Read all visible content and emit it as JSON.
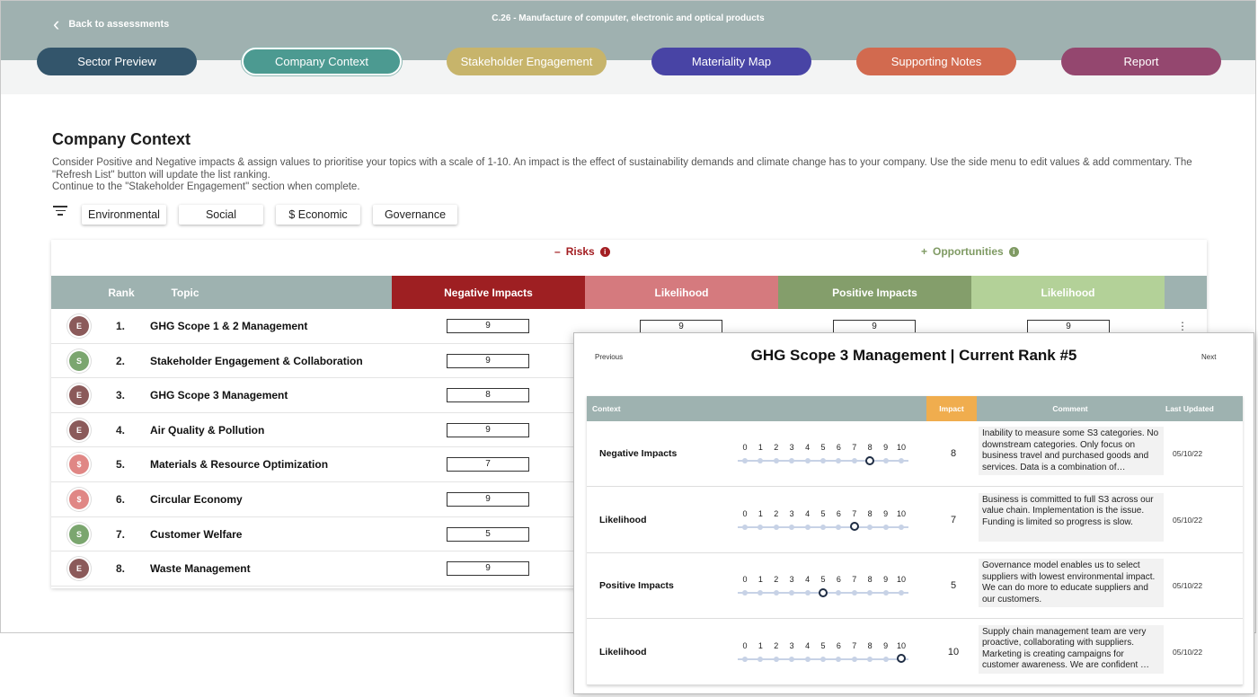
{
  "header": {
    "back_label": "Back to assessments",
    "sector_title": "C.26 - Manufacture of computer, electronic and optical products"
  },
  "nav": [
    {
      "label": "Sector Preview",
      "color": "#33556b"
    },
    {
      "label": "Company Context",
      "color": "#4c9a91",
      "active": true
    },
    {
      "label": "Stakeholder Engagement",
      "color": "#c7b46b"
    },
    {
      "label": "Materiality Map",
      "color": "#4844a5"
    },
    {
      "label": "Supporting Notes",
      "color": "#d26a4f"
    },
    {
      "label": "Report",
      "color": "#94476f"
    }
  ],
  "page": {
    "title": "Company Context",
    "desc_line1": "Consider Positive and Negative impacts & assign values to prioritise your topics with a scale of 1-10. An impact is the effect of sustainability demands and climate change has to your company. Use the side menu to edit values & add commentary. The \"Refresh List\" button will update the list ranking.",
    "desc_line2": "Continue to the \"Stakeholder Engagement\" section when complete."
  },
  "filters": [
    "Environmental",
    "Social",
    "$ Economic",
    "Governance"
  ],
  "sections": {
    "risks": {
      "prefix": "–",
      "label": "Risks",
      "color": "#a31e22"
    },
    "opportunities": {
      "prefix": "+",
      "label": "Opportunities",
      "color": "#7f9a63"
    }
  },
  "table_headers": {
    "rank": "Rank",
    "topic": "Topic",
    "negative_impacts": "Negative Impacts",
    "likelihood_risk": "Likelihood",
    "positive_impacts": "Positive Impacts",
    "likelihood_opp": "Likelihood"
  },
  "header_colors": {
    "negative": "#9e1f22",
    "likelihood_risk": "#d57a7e",
    "positive": "#849e6b",
    "likelihood_opp": "#b3d198"
  },
  "rows": [
    {
      "badge": "E",
      "badge_color": "#8b5a5a",
      "rank": "1.",
      "topic": "GHG Scope 1 & 2 Management",
      "negative": "9",
      "likelihood": "9",
      "positive": "9",
      "likelihood2": "9"
    },
    {
      "badge": "S",
      "badge_color": "#7ba66f",
      "rank": "2.",
      "topic": "Stakeholder Engagement & Collaboration",
      "negative": "9"
    },
    {
      "badge": "E",
      "badge_color": "#8b5a5a",
      "rank": "3.",
      "topic": "GHG Scope 3 Management",
      "negative": "8"
    },
    {
      "badge": "E",
      "badge_color": "#8b5a5a",
      "rank": "4.",
      "topic": "Air Quality & Pollution",
      "negative": "9"
    },
    {
      "badge": "$",
      "badge_color": "#e08785",
      "rank": "5.",
      "topic": "Materials & Resource Optimization",
      "negative": "7"
    },
    {
      "badge": "$",
      "badge_color": "#e08785",
      "rank": "6.",
      "topic": "Circular Economy",
      "negative": "9"
    },
    {
      "badge": "S",
      "badge_color": "#7ba66f",
      "rank": "7.",
      "topic": "Customer Welfare",
      "negative": "5"
    },
    {
      "badge": "E",
      "badge_color": "#8b5a5a",
      "rank": "8.",
      "topic": "Waste Management",
      "negative": "9"
    }
  ],
  "popup": {
    "prev_label": "Previous",
    "next_label": "Next",
    "title": "GHG Scope 3 Management | Current Rank #5",
    "headers": {
      "context": "Context",
      "impact": "Impact",
      "comment": "Comment",
      "last_updated": "Last Updated"
    },
    "impact_header_color": "#f0ad4e",
    "scale": [
      "0",
      "1",
      "2",
      "3",
      "4",
      "5",
      "6",
      "7",
      "8",
      "9",
      "10"
    ],
    "rows": [
      {
        "label": "Negative Impacts",
        "value": 8,
        "impact": "8",
        "comment": "Inability to measure some S3 categories. No downstream categories. Only focus on business travel and purchased goods and services. Data is a combination of…",
        "date": "05/10/22"
      },
      {
        "label": "Likelihood",
        "value": 7,
        "impact": "7",
        "comment": "Business is committed to full S3 across our value chain. Implementation is the issue. Funding is limited so progress is slow.",
        "date": "05/10/22"
      },
      {
        "label": "Positive Impacts",
        "value": 5,
        "impact": "5",
        "comment": "Governance model enables us to select suppliers with lowest environmental impact. We can do more to educate suppliers and our customers.",
        "date": "05/10/22"
      },
      {
        "label": "Likelihood",
        "value": 10,
        "impact": "10",
        "comment": "Supply chain management team are very proactive, collaborating with suppliers. Marketing is creating campaigns for customer awareness. We are confident …",
        "date": "05/10/22"
      }
    ]
  }
}
